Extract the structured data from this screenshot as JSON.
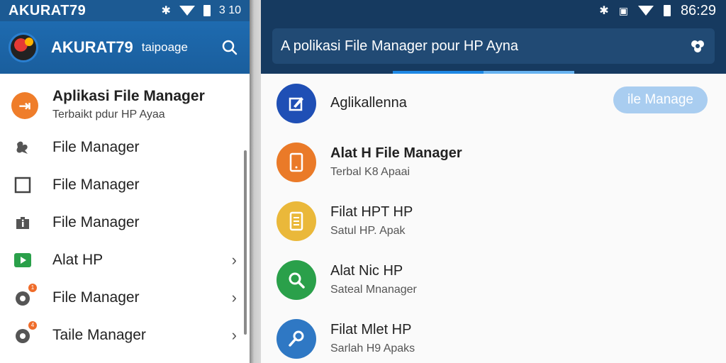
{
  "left": {
    "status": {
      "title": "AKURAT79",
      "clock": "3 10"
    },
    "appbar": {
      "name": "AKURAT79",
      "subtitle": "taipoage"
    },
    "header_item": {
      "title": "Aplikasi File Manager",
      "subtitle": "Terbaikt pdur HP Ayaa"
    },
    "items": [
      {
        "label": "File Manager",
        "icon": "puzzle-icon",
        "has_chevron": false
      },
      {
        "label": "File Manager",
        "icon": "square-icon",
        "has_chevron": false
      },
      {
        "label": "File Manager",
        "icon": "info-bag-icon",
        "has_chevron": false
      },
      {
        "label": "Alat HP",
        "icon": "play-icon",
        "has_chevron": true
      },
      {
        "label": "File Manager",
        "icon": "cog-badge-icon",
        "badge": "1",
        "has_chevron": true
      },
      {
        "label": "Taile Manager",
        "icon": "cog-badge-icon",
        "badge": "4",
        "has_chevron": true
      }
    ]
  },
  "right": {
    "status": {
      "clock": "86:29"
    },
    "search": {
      "text": "A  polikasi File Manager pour HP Ayna"
    },
    "items": [
      {
        "title": "Aglikallenna",
        "subtitle": "",
        "icon": "edit-icon",
        "color": "#1f4fb5",
        "button": "ile Manage"
      },
      {
        "title": "Alat H File Manager",
        "subtitle": "Terbal K8 Apaai",
        "icon": "phone-icon",
        "color": "#ea7a28"
      },
      {
        "title": "Filat HPT HP",
        "subtitle": "Satul HP. Apak",
        "icon": "doc-icon",
        "color": "#eab83a"
      },
      {
        "title": "Alat Nic HP",
        "subtitle": "Sateal Mnanager",
        "icon": "search-icon",
        "color": "#2aa04a"
      },
      {
        "title": "Filat Mlet HP",
        "subtitle": "Sarlah H9 Apaks",
        "icon": "link-icon",
        "color": "#2f78c4"
      }
    ]
  },
  "colors": {
    "appbar_left": "#1c5a93",
    "appbar_right": "#163a60",
    "accent": "#1e88e5"
  }
}
